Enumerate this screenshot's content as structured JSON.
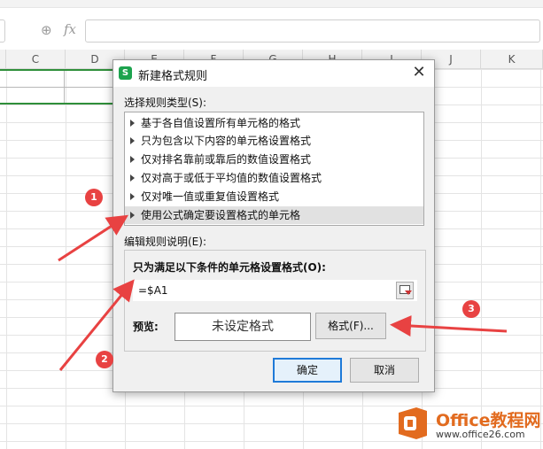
{
  "spreadsheet": {
    "formula_bar": {
      "fx_label": "fx"
    },
    "columns": [
      "C",
      "D",
      "E",
      "F",
      "G",
      "H",
      "I",
      "J",
      "K"
    ]
  },
  "dialog": {
    "title": "新建格式规则",
    "close_label": "✕",
    "rule_type_label": "选择规则类型(S):",
    "rule_types": [
      "基于各自值设置所有单元格的格式",
      "只为包含以下内容的单元格设置格式",
      "仅对排名靠前或靠后的数值设置格式",
      "仅对高于或低于平均值的数值设置格式",
      "仅对唯一值或重复值设置格式",
      "使用公式确定要设置格式的单元格"
    ],
    "selected_rule_index": 5,
    "edit_rule_label": "编辑规则说明(E):",
    "condition_label": "只为满足以下条件的单元格设置格式(O):",
    "formula_value": "=$A1",
    "preview_label": "预览:",
    "preview_text": "未设定格式",
    "format_button": "格式(F)...",
    "ok_button": "确定",
    "cancel_button": "取消"
  },
  "annotations": {
    "badge_1": "1",
    "badge_2": "2",
    "badge_3": "3",
    "arrow_color": "#e84242"
  },
  "watermark": {
    "title": "Office教程网",
    "url": "www.office26.com"
  }
}
